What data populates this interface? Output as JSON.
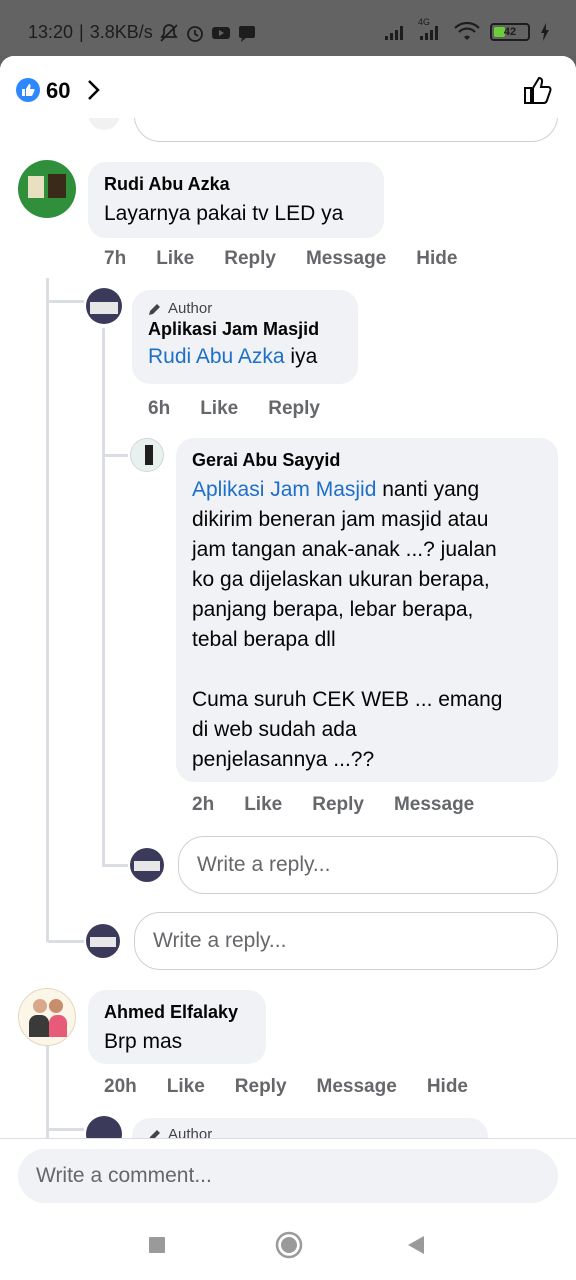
{
  "status_bar": {
    "time": "13:20",
    "speed": "3.8KB/s",
    "battery_level": "42",
    "network_type": "4G",
    "battery_fill_pct": 42
  },
  "header": {
    "like_count": "60"
  },
  "comments": [
    {
      "name": "Rudi Abu Azka",
      "text": "Layarnya pakai tv LED ya",
      "actions": [
        "7h",
        "Like",
        "Reply",
        "Message",
        "Hide"
      ],
      "reply": {
        "author_tag": "Author",
        "name": "Aplikasi Jam Masjid",
        "mention": "Rudi Abu Azka",
        "text": " iya",
        "actions": [
          "6h",
          "Like",
          "Reply"
        ],
        "sub_reply": {
          "name": "Gerai Abu Sayyid",
          "mention": "Aplikasi Jam Masjid",
          "lines": [
            " nanti yang",
            "dikirim beneran jam masjid atau",
            "jam tangan anak-anak ...? jualan",
            "ko ga dijelaskan ukuran berapa,",
            "panjang berapa, lebar berapa,",
            "tebal berapa dll",
            "",
            "Cuma suruh CEK WEB ... emang",
            "di web sudah ada",
            "penjelasannya ...??"
          ],
          "actions": [
            "2h",
            "Like",
            "Reply",
            "Message"
          ]
        },
        "reply_placeholder": "Write a reply..."
      },
      "reply_placeholder": "Write a reply..."
    },
    {
      "name": "Ahmed Elfalaky",
      "text": "Brp mas",
      "actions": [
        "20h",
        "Like",
        "Reply",
        "Message",
        "Hide"
      ],
      "partial_author_tag": "Author"
    }
  ],
  "comment_placeholder": "Write a comment...",
  "colors": {
    "accent": "#2d88ff",
    "mention": "#1d6fc9",
    "bubble": "#f0f2f5",
    "muted": "#65676b"
  }
}
